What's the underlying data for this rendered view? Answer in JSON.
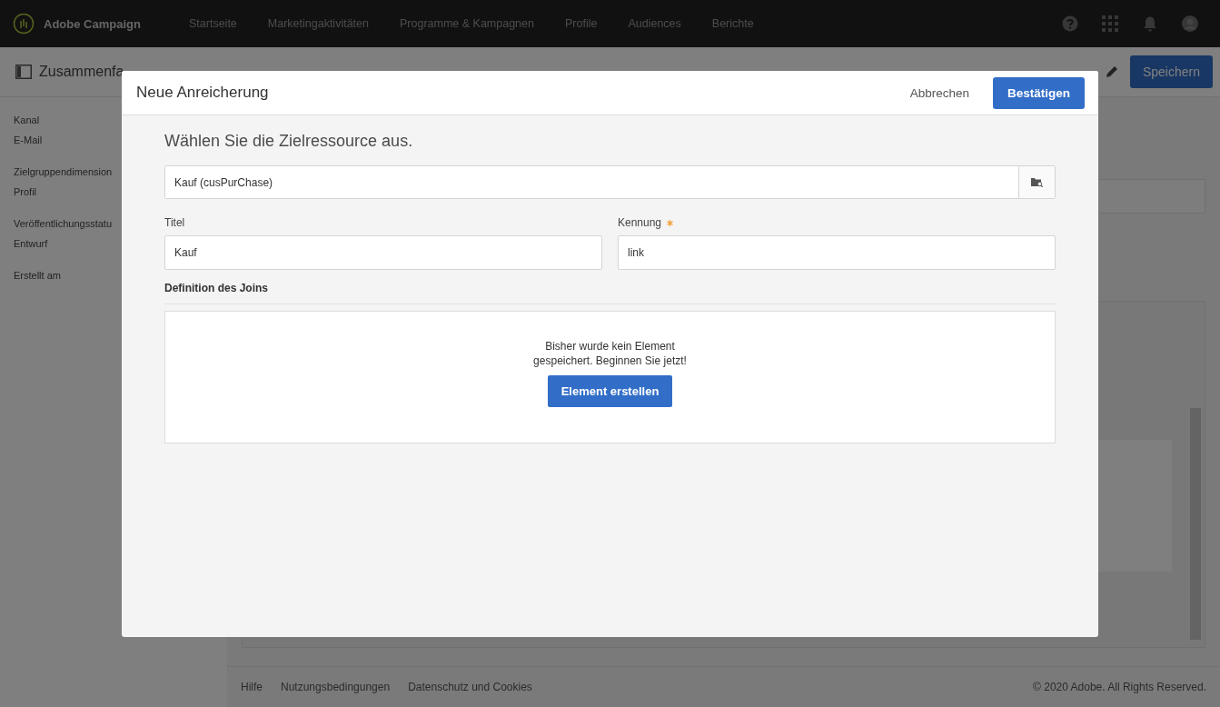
{
  "topbar": {
    "brand": "Adobe Campaign",
    "nav": [
      {
        "label": "Startseite"
      },
      {
        "label": "Marketingaktivitäten"
      },
      {
        "label": "Programme & Kampagnen"
      },
      {
        "label": "Profile"
      },
      {
        "label": "Audiences"
      },
      {
        "label": "Berichte"
      }
    ]
  },
  "subheader": {
    "title": "Zusammenfa",
    "save": "Speichern"
  },
  "sidebar": {
    "items": [
      {
        "label": "Kanal",
        "value": "E-Mail"
      },
      {
        "label": "Zielgruppendimension",
        "value": "Profil"
      },
      {
        "label": "Veröffentlichungsstatu",
        "value": "Entwurf"
      },
      {
        "label": "Erstellt am"
      }
    ]
  },
  "footer": {
    "links": [
      "Hilfe",
      "Nutzungsbedingungen",
      "Datenschutz und Cookies"
    ],
    "copyright": "© 2020 Adobe. All Rights Reserved."
  },
  "dialog": {
    "title": "Neue Anreicherung",
    "cancel": "Abbrechen",
    "confirm": "Bestätigen",
    "heading": "Wählen Sie die Zielressource aus.",
    "resource": "Kauf (cusPurChase)",
    "fields": [
      {
        "label": "Titel",
        "value": "Kauf",
        "required": false
      },
      {
        "label": "Kennung",
        "value": "link",
        "required": true
      }
    ],
    "join_title": "Definition des Joins",
    "empty_message": "Bisher wurde kein Element gespeichert. Beginnen Sie jetzt!",
    "create_button": "Element erstellen"
  }
}
